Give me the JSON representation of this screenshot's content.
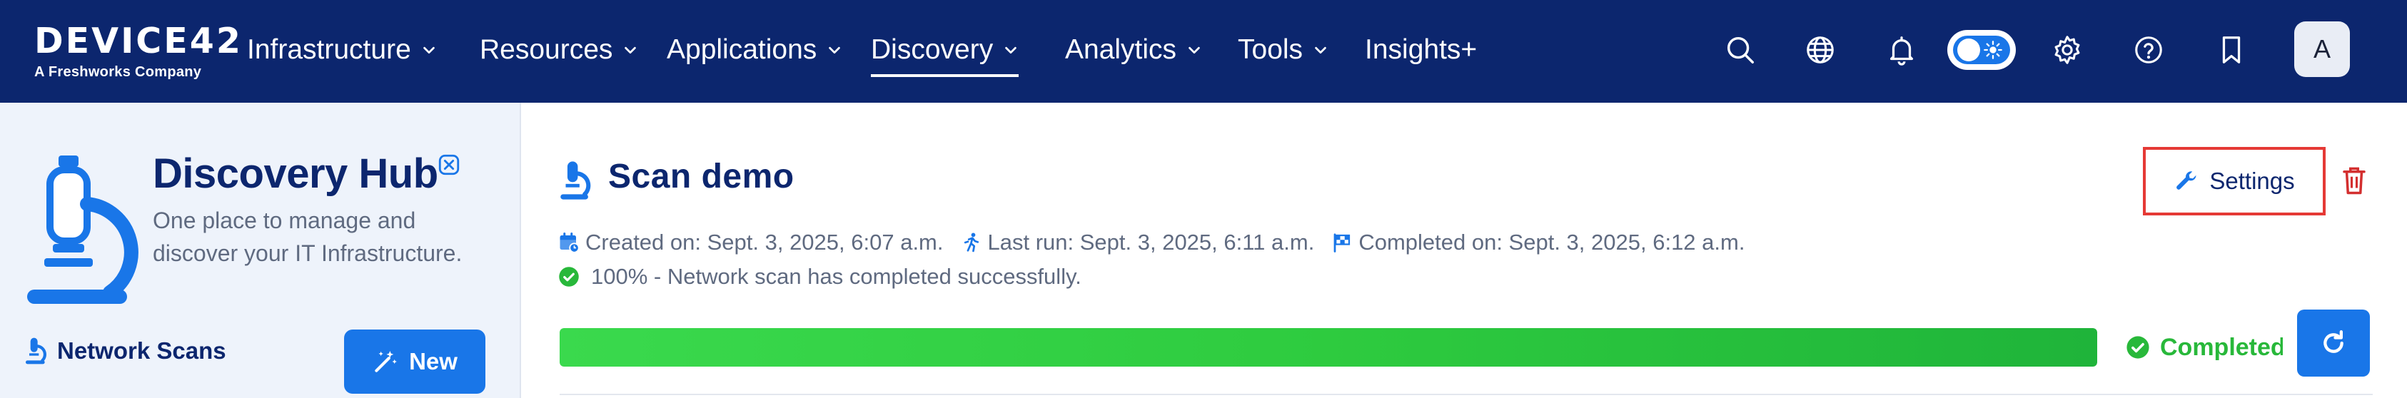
{
  "brand": {
    "logo_text": "DEVICE42",
    "logo_subtitle": "A Freshworks Company"
  },
  "nav": {
    "items": [
      {
        "label": "Infrastructure",
        "has_dropdown": true,
        "active": false
      },
      {
        "label": "Resources",
        "has_dropdown": true,
        "active": false
      },
      {
        "label": "Applications",
        "has_dropdown": true,
        "active": false
      },
      {
        "label": "Discovery",
        "has_dropdown": true,
        "active": true
      },
      {
        "label": "Analytics",
        "has_dropdown": true,
        "active": false
      },
      {
        "label": "Tools",
        "has_dropdown": true,
        "active": false
      },
      {
        "label": "Insights+",
        "has_dropdown": false,
        "active": false
      }
    ],
    "icons": [
      "search-icon",
      "globe-icon",
      "bell-icon",
      "theme-toggle",
      "gear-icon",
      "help-icon",
      "bookmark-icon"
    ],
    "theme_toggle_on": true,
    "avatar_initial": "A"
  },
  "sidebar": {
    "title": "Discovery Hub",
    "subtitle": "One place to manage and discover your IT Infrastructure.",
    "section_title": "Network Scans",
    "new_button_label": "New"
  },
  "scan": {
    "title": "Scan demo",
    "settings_label": "Settings",
    "created_on": "Created on: Sept. 3, 2025, 6:07 a.m.",
    "last_run": "Last run: Sept. 3, 2025, 6:11 a.m.",
    "completed_on": "Completed on: Sept. 3, 2025, 6:12 a.m.",
    "status_message": "100% - Network scan has completed successfully.",
    "progress_percent": 100,
    "status_label": "Completed"
  },
  "colors": {
    "nav_bg": "#0c266e",
    "accent": "#1976e8",
    "success": "#28b83a",
    "danger": "#e53935"
  }
}
